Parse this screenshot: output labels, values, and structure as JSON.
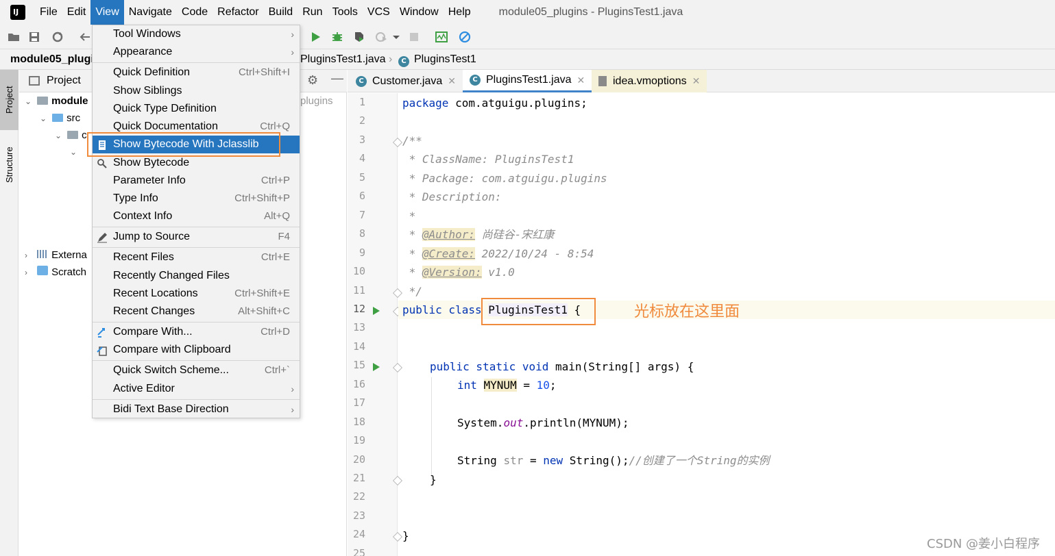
{
  "menubar": {
    "items": [
      "File",
      "Edit",
      "View",
      "Navigate",
      "Code",
      "Refactor",
      "Build",
      "Run",
      "Tools",
      "VCS",
      "Window",
      "Help"
    ],
    "active": "View",
    "window_title": "module05_plugins - PluginsTest1.java"
  },
  "navbar": {
    "project": "module05_plugi",
    "file": "PluginsTest1.java",
    "class": "PluginsTest1"
  },
  "left_strip": {
    "project_tab": "Project",
    "structure_tab": "Structure"
  },
  "project_panel": {
    "title": "Project",
    "tree": {
      "module": "module",
      "src": "src",
      "c": "c",
      "partial_path": "plugins",
      "external": "Externa",
      "scratch": "Scratch"
    }
  },
  "editor_tabs": [
    {
      "label": "Customer.java",
      "active": false
    },
    {
      "label": "PluginsTest1.java",
      "active": true
    },
    {
      "label": "idea.vmoptions",
      "active": false
    }
  ],
  "view_menu": {
    "items": [
      {
        "label": "Tool Windows",
        "shortcut": "",
        "submenu": true
      },
      {
        "label": "Appearance",
        "shortcut": "",
        "submenu": true
      },
      {
        "label": "Quick Definition",
        "shortcut": "Ctrl+Shift+I"
      },
      {
        "label": "Show Siblings",
        "shortcut": ""
      },
      {
        "label": "Quick Type Definition",
        "shortcut": ""
      },
      {
        "label": "Quick Documentation",
        "shortcut": "Ctrl+Q"
      },
      {
        "label": "Show Bytecode With Jclasslib",
        "shortcut": "",
        "selected": true
      },
      {
        "label": "Show Bytecode",
        "shortcut": ""
      },
      {
        "label": "Parameter Info",
        "shortcut": "Ctrl+P"
      },
      {
        "label": "Type Info",
        "shortcut": "Ctrl+Shift+P"
      },
      {
        "label": "Context Info",
        "shortcut": "Alt+Q"
      },
      {
        "label": "Jump to Source",
        "shortcut": "F4"
      },
      {
        "label": "Recent Files",
        "shortcut": "Ctrl+E"
      },
      {
        "label": "Recently Changed Files",
        "shortcut": ""
      },
      {
        "label": "Recent Locations",
        "shortcut": "Ctrl+Shift+E"
      },
      {
        "label": "Recent Changes",
        "shortcut": "Alt+Shift+C"
      },
      {
        "label": "Compare With...",
        "shortcut": "Ctrl+D"
      },
      {
        "label": "Compare with Clipboard",
        "shortcut": ""
      },
      {
        "label": "Quick Switch Scheme...",
        "shortcut": "Ctrl+`"
      },
      {
        "label": "Active Editor",
        "shortcut": "",
        "submenu": true
      },
      {
        "label": "Bidi Text Base Direction",
        "shortcut": "",
        "submenu": true
      }
    ]
  },
  "code": {
    "line_numbers": [
      "1",
      "2",
      "3",
      "4",
      "5",
      "6",
      "7",
      "8",
      "9",
      "10",
      "11",
      "12",
      "13",
      "14",
      "15",
      "16",
      "17",
      "18",
      "19",
      "20",
      "21",
      "22",
      "23",
      "24",
      "25"
    ],
    "l1_kw": "package",
    "l1_rest": " com.atguigu.plugins;",
    "l3": "/**",
    "l4": " * ClassName: PluginsTest1",
    "l5": " * Package: com.atguigu.plugins",
    "l6": " * Description:",
    "l7": " *",
    "l8_pre": " * ",
    "l8_tag": "@Author:",
    "l8_val": " 尚硅谷-宋红康",
    "l9_pre": " * ",
    "l9_tag": "@Create:",
    "l9_val": " 2022/10/24 - 8:54",
    "l10_pre": " * ",
    "l10_tag": "@Version:",
    "l10_val": " v1.0",
    "l11": " */",
    "l12_kw": "public class ",
    "l12_name": "PluginsTest1",
    "l12_rest": " {",
    "l15_kw": "public static void ",
    "l15_rest": "main(String[] args) {",
    "l16_kw": "int ",
    "l16_var": "MYNUM",
    "l16_eq": " = ",
    "l16_num": "10",
    "l16_end": ";",
    "l18_a": "System.",
    "l18_fld": "out",
    "l18_b": ".println(MYNUM);",
    "l20_a": "String ",
    "l20_var": "str",
    "l20_eq": " = ",
    "l20_kw": "new",
    "l20_b": " String();",
    "l20_cmt": "//创建了一个String的实例",
    "l21": "}",
    "l24": "}"
  },
  "annotation": "光标放在这里面",
  "watermark": "CSDN @姜小白程序",
  "colors": {
    "accent": "#2675bf",
    "highlight_box": "#f08a3c",
    "keyword": "#0033b3"
  }
}
